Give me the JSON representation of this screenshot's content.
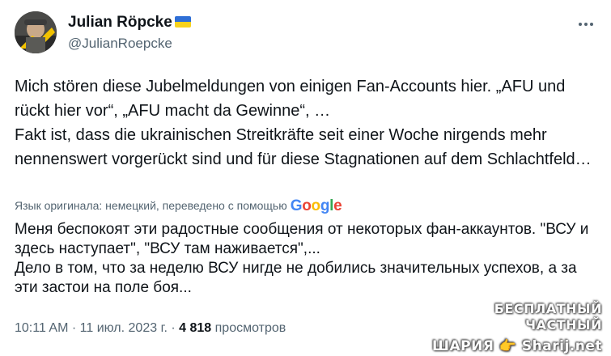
{
  "author": {
    "display_name": "Julian Röpcke",
    "handle": "@JulianRoepcke",
    "flag": "ukraine-flag"
  },
  "tweet": {
    "text": "Mich stören diese Jubelmeldungen von einigen Fan-Accounts hier. „AFU und rückt hier vor“, „AFU macht da Gewinne“, …\nFakt ist, dass die ukrainischen Streitkräfte seit einer Woche nirgends mehr nennenswert vorgerückt sind und für diese  Stagnationen auf dem Schlachtfeld…",
    "translation_note": "Язык оригинала: немецкий, переведено с помощью",
    "translation_provider": "Google",
    "translated_text": "Меня беспокоят эти радостные сообщения от некоторых фан-аккаунтов. \"ВСУ и здесь наступает\", \"ВСУ там наживается\",...\nДело в том, что за неделю ВСУ нигде не добились значительных успехов, а за эти застои на поле боя..."
  },
  "meta": {
    "time": "10:11 AM",
    "separator": "·",
    "date": "11 июл. 2023 г.",
    "views_count": "4 818",
    "views_label": "просмотров"
  },
  "watermark": {
    "line1": "БЕСПЛАТНЫЙ ЧАСТНЫЙ",
    "line2": "ШАРИЯ 👉 Sharij.net"
  },
  "colors": {
    "text": "#0f1419",
    "secondary": "#536471"
  }
}
